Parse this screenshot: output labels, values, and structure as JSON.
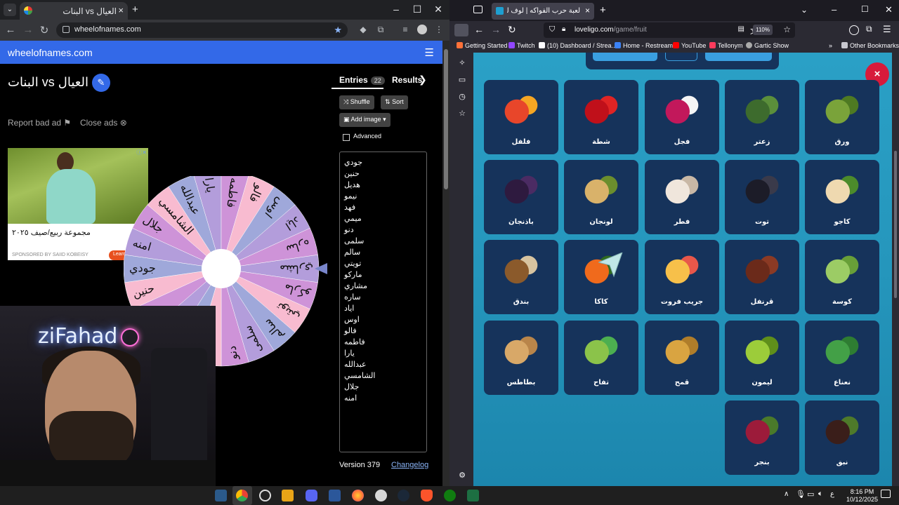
{
  "left_browser": {
    "tab_title": "البنات vs العيال",
    "url": "wheelofnames.com",
    "brand": "wheelofnames.com",
    "wheel_title": "البنات vs العيال",
    "report_ad": "Report bad ad",
    "close_ads": "Close ads",
    "ad": {
      "headline": "مجموعة ربيع/صيف ٢٠٢٥",
      "sponsored": "SPONSORED BY SAIID KOBEISY",
      "cta": "Learn"
    },
    "tabs": {
      "entries": "Entries",
      "entries_count": "22",
      "results": "Results"
    },
    "buttons": {
      "shuffle": "Shuffle",
      "sort": "Sort",
      "add_image": "Add image",
      "advanced": "Advanced"
    },
    "entries": [
      "جودي",
      "حنين",
      "هديل",
      "نيمو",
      "فهد",
      "ميمي",
      "دنو",
      "سلمى",
      "سالم",
      "تويتي",
      "ماركو",
      "مشاري",
      "ساره",
      "اياد",
      "اوس",
      "فالو",
      "فاطمه",
      "يارا",
      "عبدالله",
      "الشامسي",
      "جلال",
      "امنه"
    ],
    "version": "Version 379",
    "changelog": "Changelog"
  },
  "wheel": {
    "segments": [
      "مشاري",
      "ماركو",
      "تويتي",
      "سالم",
      "سلمى",
      "دنو",
      "ميمي",
      "فهد",
      "نيمو",
      "هديل",
      "حنين",
      "جودي",
      "امنه",
      "جلال",
      "الشامسي",
      "عبدالله",
      "يارا",
      "فاطمه",
      "فالو",
      "اوس",
      "اياد",
      "ساره"
    ],
    "colors": [
      "#b39ddb",
      "#ce93d8",
      "#f8bbd0",
      "#9fa8da"
    ]
  },
  "webcam": {
    "neon_text": "ziFahad"
  },
  "right_browser": {
    "tab_title": "لعبة حرب الفواكه | لوف ليجو يو",
    "url_domain": "loveligo.com",
    "url_path": "/game/fruit",
    "zoom": "110%",
    "bookmarks": [
      "Getting Started",
      "Twitch",
      "(10) Dashboard / Strea...",
      "Home - Restream",
      "YouTube",
      "Tellonym",
      "Gartic Show"
    ],
    "other_bookmarks": "Other Bookmarks",
    "close_label": "×"
  },
  "cards": [
    {
      "label": "فلفل",
      "icon": "pepper-icon",
      "row": 0,
      "col": 0
    },
    {
      "label": "شطة",
      "icon": "chili-icon",
      "row": 0,
      "col": 1
    },
    {
      "label": "فجل",
      "icon": "radish-icon",
      "row": 0,
      "col": 2
    },
    {
      "label": "زعتر",
      "icon": "thyme-icon",
      "row": 0,
      "col": 3
    },
    {
      "label": "ورق",
      "icon": "vine-leaf-icon",
      "row": 0,
      "col": 4
    },
    {
      "label": "باذنجان",
      "icon": "eggplant-icon",
      "row": 1,
      "col": 0
    },
    {
      "label": "لونجان",
      "icon": "longan-icon",
      "row": 1,
      "col": 1
    },
    {
      "label": "فطر",
      "icon": "mushroom-icon",
      "row": 1,
      "col": 2
    },
    {
      "label": "توت",
      "icon": "blackberry-icon",
      "row": 1,
      "col": 3
    },
    {
      "label": "كاجو",
      "icon": "cashew-icon",
      "row": 1,
      "col": 4
    },
    {
      "label": "بندق",
      "icon": "hazelnut-icon",
      "row": 2,
      "col": 0
    },
    {
      "label": "كاكا",
      "icon": "persimmon-icon",
      "row": 2,
      "col": 1
    },
    {
      "label": "جريب فروت",
      "icon": "grapefruit-icon",
      "row": 2,
      "col": 2
    },
    {
      "label": "قرنفل",
      "icon": "clove-icon",
      "row": 2,
      "col": 3
    },
    {
      "label": "كوسة",
      "icon": "zucchini-icon",
      "row": 2,
      "col": 4
    },
    {
      "label": "بطاطس",
      "icon": "potato-icon",
      "row": 3,
      "col": 0
    },
    {
      "label": "تفاح",
      "icon": "apple-icon",
      "row": 3,
      "col": 1
    },
    {
      "label": "قمح",
      "icon": "wheat-icon",
      "row": 3,
      "col": 2
    },
    {
      "label": "ليمون",
      "icon": "lime-icon",
      "row": 3,
      "col": 3
    },
    {
      "label": "نعناع",
      "icon": "mint-icon",
      "row": 3,
      "col": 4
    },
    {
      "label": "بنجر",
      "icon": "beet-icon",
      "row": 4,
      "col": 3
    },
    {
      "label": "نبق",
      "icon": "jujube-icon",
      "row": 4,
      "col": 4
    }
  ],
  "taskbar": {
    "lang": "ع",
    "time": "8:16 PM",
    "date": "10/12/2025"
  }
}
